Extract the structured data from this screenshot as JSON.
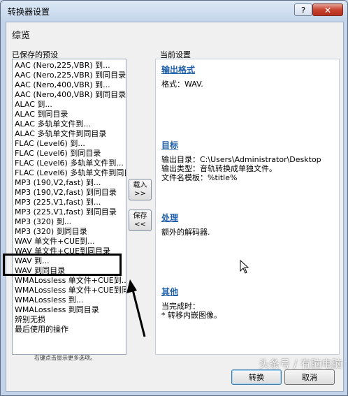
{
  "window": {
    "title": "转换器设置",
    "help": "?",
    "close": "✕"
  },
  "header": {
    "title": "综览"
  },
  "presets": {
    "label": "已保存的预设",
    "items": [
      "AAC (Nero,225,VBR) 到...",
      "AAC (Nero,225,VBR) 到同目录",
      "AAC (Nero,400,VBR) 到...",
      "AAC (Nero,400,VBR) 到同目录",
      "ALAC 到...",
      "ALAC 到同目录",
      "ALAC 多轨单文件到...",
      "ALAC 多轨单文件到同目录",
      "FLAC (Level6) 到...",
      "FLAC (Level6) 到同目录",
      "FLAC (Level6) 多轨单文件到...",
      "FLAC (Level6) 多轨单文件到同目",
      "MP3 (190,V2,fast) 到...",
      "MP3 (190,V2,fast) 到同目录",
      "MP3 (225,V1,fast) 到...",
      "MP3 (225,V1,fast) 到同目录",
      "MP3 (320) 到...",
      "MP3 (320) 到同目录",
      "WAV 单文件+CUE到...",
      "WAV 单文件+CUE到同目录",
      "WAV 到...",
      "WAV 到同目录",
      "WMALossless 单文件+CUE到...",
      "WMALossless 单文件+CUE到同",
      "WMALossless 到...",
      "WMALossless 到同目录",
      "辨别无损",
      "最后使用的操作"
    ],
    "hint": "右键点击显示更多选项。"
  },
  "middle": {
    "load_label": "载入\n>>",
    "save_label": "保存\n<<"
  },
  "current": {
    "label": "当前设置",
    "output_format": {
      "heading": "输出格式",
      "line": "格式：WAV."
    },
    "target": {
      "heading": "目标",
      "lines": [
        "输出目录：C:\\Users\\Administrator\\Desktop",
        "输出类型：音轨转换成单独文件。",
        "文件名模板：%title%"
      ]
    },
    "processing": {
      "heading": "处理",
      "line": "额外的解码器."
    },
    "other": {
      "heading": "其他",
      "lines": [
        "当完成时：",
        "* 转移内嵌图像。"
      ]
    }
  },
  "footer": {
    "ok_label": "转换",
    "cancel_label": "取消"
  },
  "watermark": "头条号 / 有脑电脑"
}
